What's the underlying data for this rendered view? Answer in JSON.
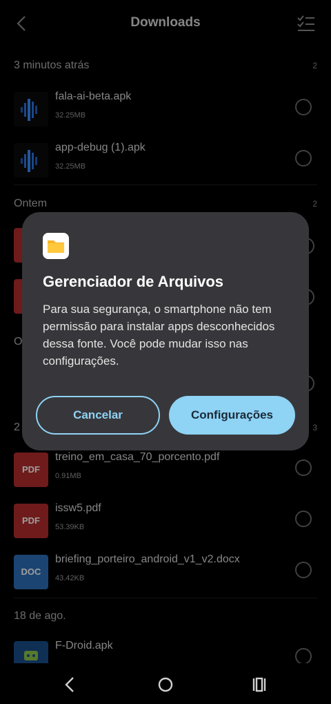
{
  "header": {
    "title": "Downloads",
    "back_icon": "back-arrow-icon",
    "select_icon": "checklist-icon"
  },
  "sections": [
    {
      "label": "3 minutos atrás",
      "count": "2"
    },
    {
      "label": "Ontem",
      "count": "2"
    },
    {
      "label": "O",
      "count": ""
    },
    {
      "label": "2",
      "count": "3"
    },
    {
      "label": "18 de ago.",
      "count": ""
    }
  ],
  "items": [
    {
      "name": "fala-ai-beta.apk",
      "size": "32.25MB",
      "thumb": "apk"
    },
    {
      "name": "app-debug (1).apk",
      "size": "32.25MB",
      "thumb": "apk"
    },
    {
      "name": "treino_em_casa_70_porcento.pdf",
      "size": "0.91MB",
      "thumb": "PDF"
    },
    {
      "name": "issw5.pdf",
      "size": "53.39KB",
      "thumb": "PDF"
    },
    {
      "name": "briefing_porteiro_android_v1_v2.docx",
      "size": "43.42KB",
      "thumb": "DOC"
    },
    {
      "name": "F-Droid.apk",
      "size": "",
      "thumb": "fdroid"
    }
  ],
  "dialog": {
    "title": "Gerenciador de Arquivos",
    "body": "Para sua segurança, o smartphone não tem permissão para instalar apps desconhecidos dessa fonte. Você pode mudar isso nas configurações.",
    "cancel_label": "Cancelar",
    "confirm_label": "Configurações"
  },
  "colors": {
    "accent": "#8fd3f5",
    "dialog_bg": "#37373b",
    "pdf": "#b42d2d",
    "doc": "#2c6eb8"
  }
}
